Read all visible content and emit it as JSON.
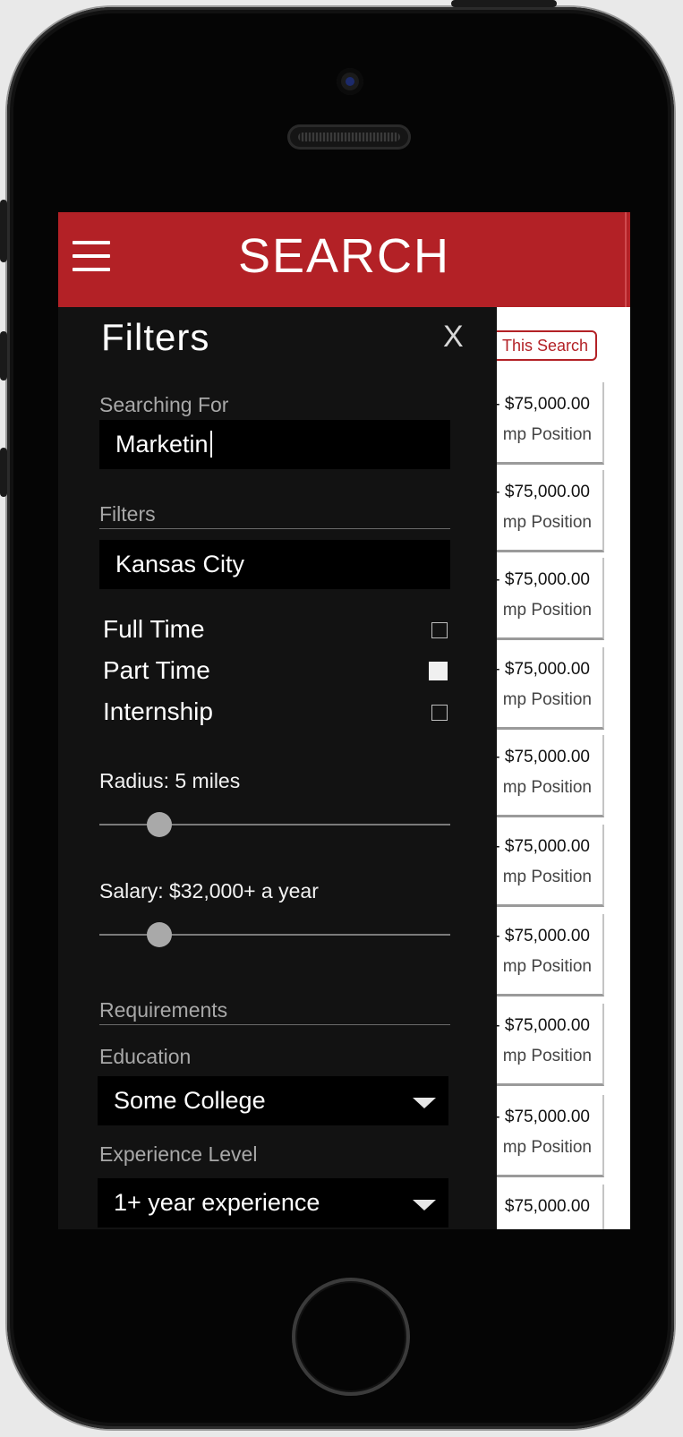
{
  "header": {
    "title": "SEARCH",
    "menu_icon": "hamburger-menu-icon",
    "accent_color": "#b32126"
  },
  "results": {
    "save_search_label": "This Search",
    "cards": [
      {
        "salary": "- $75,000.00",
        "position": "mp Position"
      },
      {
        "salary": "- $75,000.00",
        "position": "mp Position"
      },
      {
        "salary": "- $75,000.00",
        "position": "mp Position"
      },
      {
        "salary": "- $75,000.00",
        "position": "mp Position"
      },
      {
        "salary": "- $75,000.00",
        "position": "mp Position"
      },
      {
        "salary": "- $75,000.00",
        "position": "mp Position"
      },
      {
        "salary": "- $75,000.00",
        "position": "mp Position"
      },
      {
        "salary": "- $75,000.00",
        "position": "mp Position"
      },
      {
        "salary": "- $75,000.00",
        "position": "mp Position"
      },
      {
        "salary": "$75,000.00",
        "position": ""
      }
    ]
  },
  "filters": {
    "title": "Filters",
    "close_label": "X",
    "searching_for": {
      "label": "Searching For",
      "value": "Marketin"
    },
    "section_filters_label": "Filters",
    "location": {
      "value": "Kansas City"
    },
    "job_types": [
      {
        "label": "Full Time",
        "checked": false
      },
      {
        "label": "Part Time",
        "checked": true
      },
      {
        "label": "Internship",
        "checked": false
      }
    ],
    "radius": {
      "label": "Radius: 5 miles",
      "fraction": 0.17
    },
    "salary": {
      "label": "Salary: $32,000+ a year",
      "fraction": 0.17
    },
    "requirements_label": "Requirements",
    "education": {
      "label": "Education",
      "value": "Some College"
    },
    "experience": {
      "label": "Experience Level",
      "value": "1+ year experience"
    }
  }
}
